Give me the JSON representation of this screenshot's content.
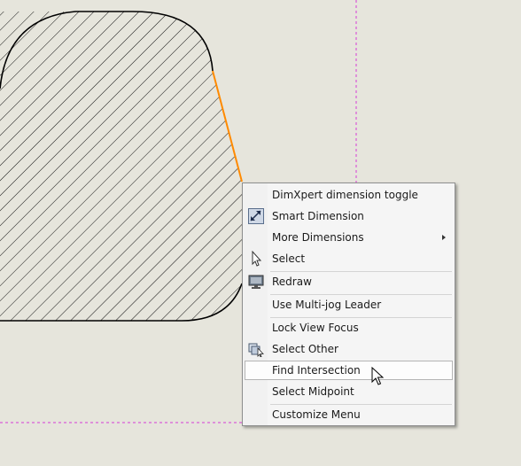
{
  "colors": {
    "background": "#e6e5dc",
    "sketch_line": "#000000",
    "selected_edge": "#ff8a00",
    "construction_line": "#d63ad6",
    "menu_background": "#f5f5f5"
  },
  "menu": {
    "items": [
      {
        "label": "DimXpert dimension toggle",
        "icon": "none"
      },
      {
        "label": "Smart Dimension",
        "icon": "smart-dimension-icon"
      },
      {
        "label": "More Dimensions",
        "icon": "none",
        "submenu": true
      },
      {
        "label": "Select",
        "icon": "pointer-icon"
      },
      {
        "label": "Redraw",
        "icon": "redraw-icon"
      },
      {
        "label": "Use Multi-jog Leader",
        "icon": "none"
      },
      {
        "label": "Lock View Focus",
        "icon": "none"
      },
      {
        "label": "Select Other",
        "icon": "select-other-icon"
      },
      {
        "label": "Find Intersection",
        "icon": "none",
        "highlighted": true
      },
      {
        "label": "Select Midpoint",
        "icon": "none"
      },
      {
        "label": "Customize Menu",
        "icon": "none"
      }
    ]
  }
}
